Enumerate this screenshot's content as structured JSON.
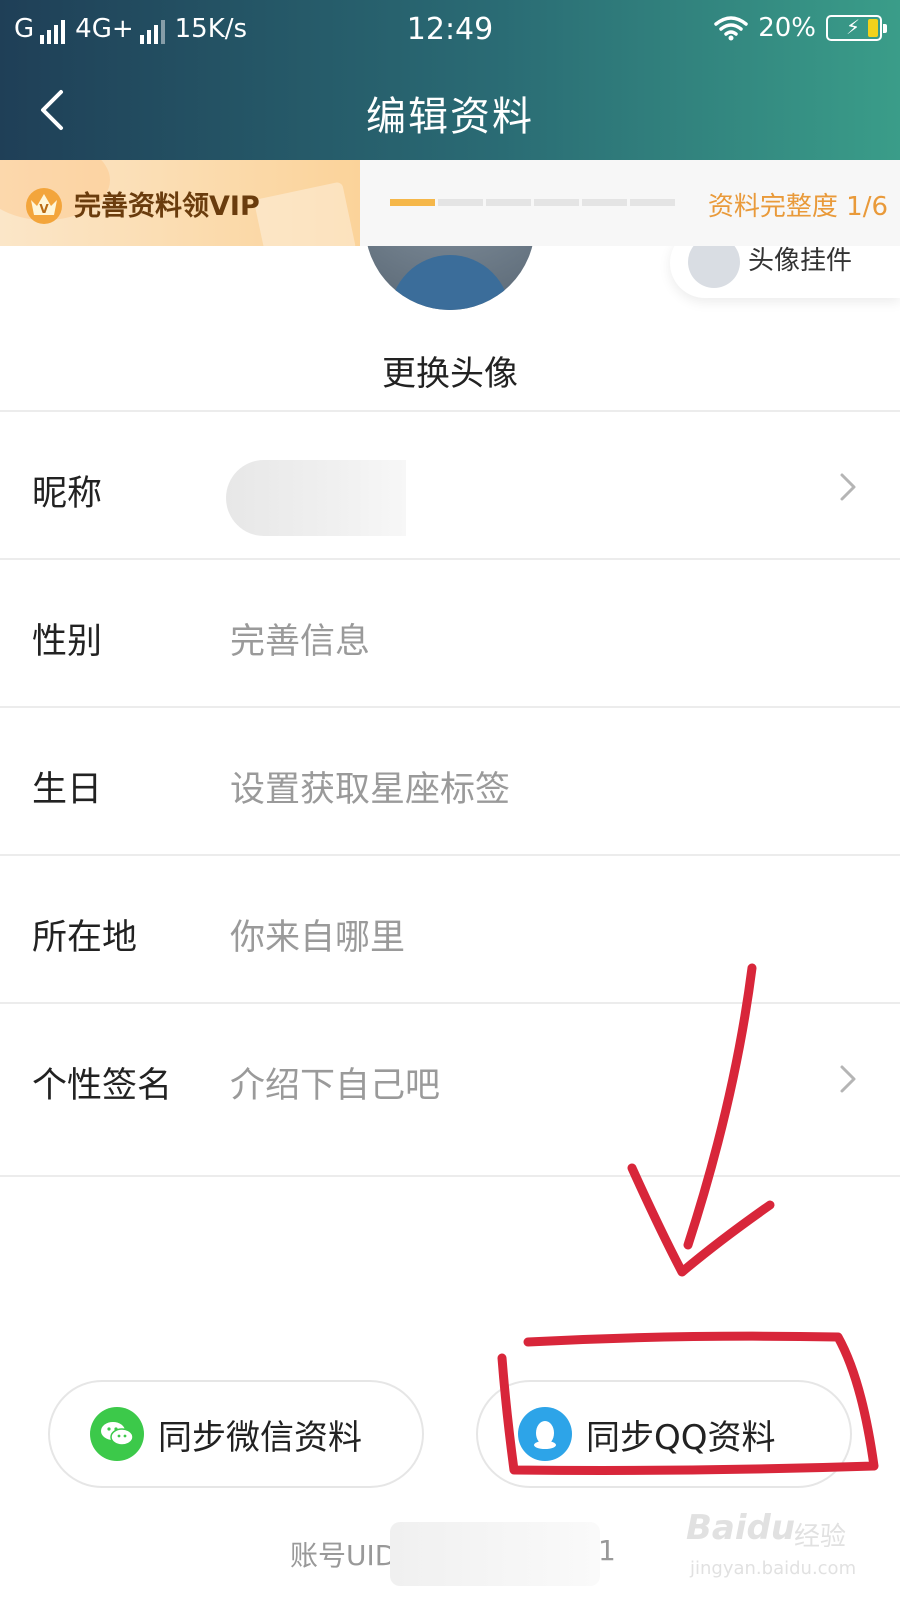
{
  "status_bar": {
    "carrier1": "G",
    "carrier2": "4G+",
    "speed": "15K/s",
    "time": "12:49",
    "battery": "20%",
    "battery_level": 0.2,
    "battery_fill_color": "#f2d21b"
  },
  "header": {
    "title": "编辑资料",
    "back_icon": "chevron-left-icon",
    "gradient_start": "#1f3f57",
    "gradient_end": "#3a9d89"
  },
  "vip_banner": {
    "text": "完善资料领VIP",
    "badge_icon": "crown-icon",
    "deco_text": "VIP",
    "progress_segments": 6,
    "progress_filled": 1,
    "completeness_label": "资料完整度 1/6",
    "accent_color": "#e99a3a"
  },
  "avatar": {
    "change_label": "更换头像",
    "pendant_label": "头像挂件"
  },
  "profile_rows": [
    {
      "label": "昵称",
      "value": "",
      "has_chevron": true
    },
    {
      "label": "性别",
      "value": "完善信息",
      "has_chevron": false
    },
    {
      "label": "生日",
      "value": "设置获取星座标签",
      "has_chevron": false
    },
    {
      "label": "所在地",
      "value": "你来自哪里",
      "has_chevron": false
    },
    {
      "label": "个性签名",
      "value": "介绍下自己吧",
      "has_chevron": true
    }
  ],
  "sync_buttons": {
    "wechat_label": "同步微信资料",
    "wechat_icon": "wechat-icon",
    "qq_label": "同步QQ资料",
    "qq_icon": "qq-penguin-icon"
  },
  "account": {
    "uid_label": "账号UID",
    "uid_tail": "1"
  },
  "watermark": {
    "brand": "Baidu",
    "cn": "经验",
    "url": "jingyan.baidu.com"
  },
  "annotation_color": "#d8263a"
}
